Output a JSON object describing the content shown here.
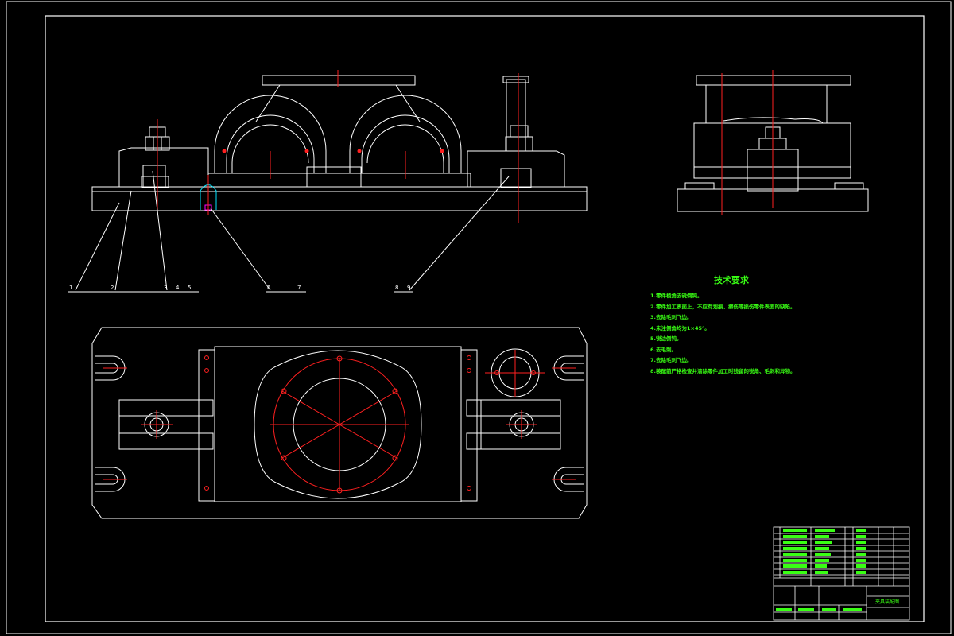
{
  "colors": {
    "background": "#000000",
    "outline": "#ffffff",
    "centerline": "#ff2020",
    "annotation": "#39ff14",
    "hatch": "#00e5ff",
    "accent": "#ff00ff"
  },
  "technical_requirements": {
    "title": "技术要求",
    "items": [
      "1.零件棱角去锐倒钝。",
      "2.零件加工表面上，不应有划痕、擦伤等损伤零件表面的缺陷。",
      "3.去除毛刺飞边。",
      "4.未注倒角均为1×45°。",
      "5.锐边倒钝。",
      "6.去毛刺。",
      "7.去除毛刺飞边。",
      "8.装配前严格检查并清除零件加工时残留的锐角、毛刺和异物。"
    ]
  },
  "balloons": [
    "1",
    "2",
    "3",
    "4",
    "5",
    "6",
    "7",
    "8",
    "9"
  ],
  "title_block": {
    "drawing_name": "夹具装配图"
  }
}
